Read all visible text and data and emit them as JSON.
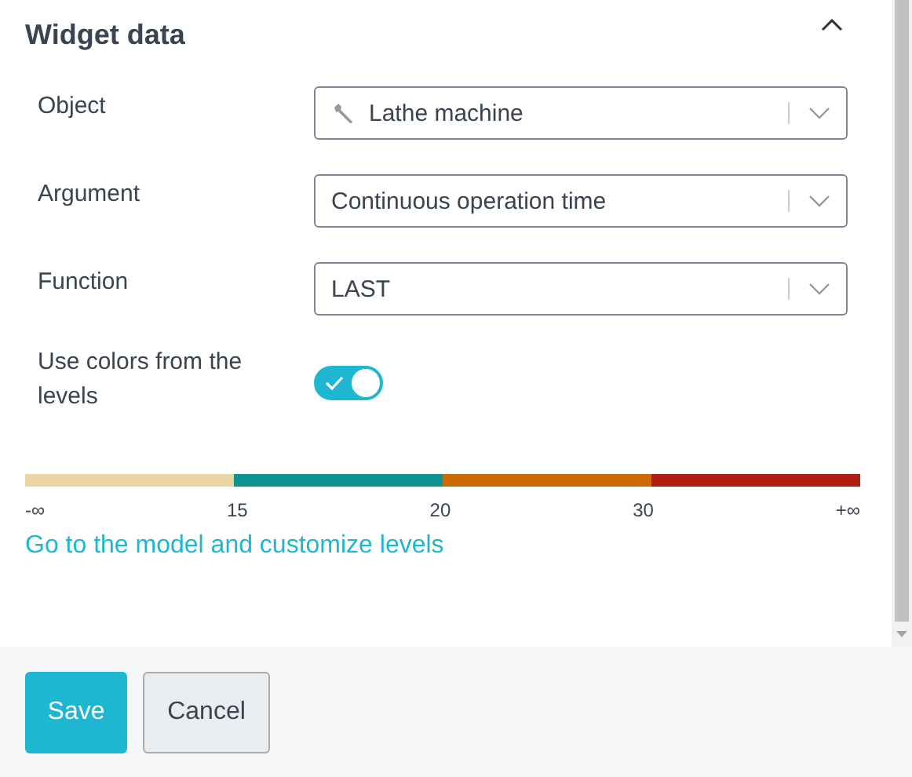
{
  "section": {
    "title": "Widget data",
    "expanded": true
  },
  "fields": [
    {
      "label": "Object",
      "value": "Lathe machine",
      "kind": "object-select"
    },
    {
      "label": "Argument",
      "value": "Continuous operation time",
      "kind": "select"
    },
    {
      "label": "Function",
      "value": "LAST",
      "kind": "select"
    }
  ],
  "toggle": {
    "label": "Use colors from the levels",
    "on": true
  },
  "levels": [
    {
      "color": "#e8d6a4"
    },
    {
      "color": "#0e9393"
    },
    {
      "color": "#cc6a06"
    },
    {
      "color": "#b11c13"
    }
  ],
  "ticks": [
    "-∞",
    "15",
    "20",
    "30",
    "+∞"
  ],
  "link": "Go to the model and customize levels",
  "buttons": [
    {
      "label": "Save",
      "kind": "primary"
    },
    {
      "label": "Cancel",
      "kind": "secondary"
    }
  ]
}
